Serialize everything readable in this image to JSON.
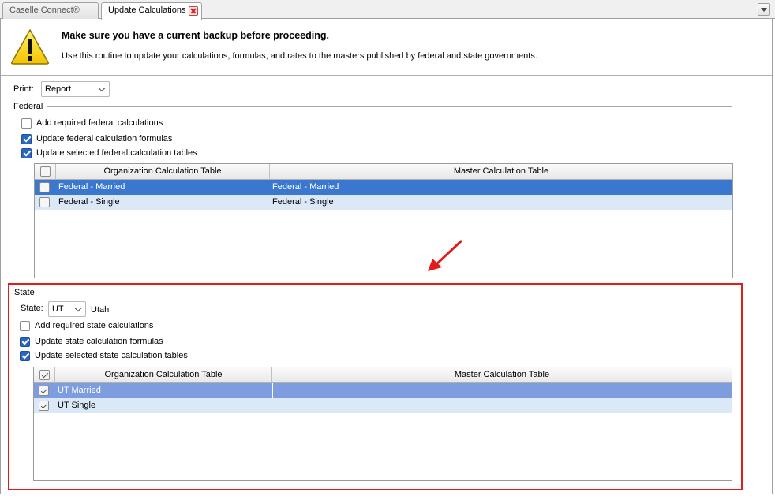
{
  "tabs": [
    {
      "label": "Caselle Connect®",
      "active": false
    },
    {
      "label": "Update Calculations",
      "active": true
    }
  ],
  "icons": {
    "tab_close": "close-icon",
    "tab_menu": "chevron-down-icon",
    "warning": "warning-icon",
    "arrow": "red-arrow-icon"
  },
  "banner": {
    "title": "Make sure you have a current backup before proceeding.",
    "subtitle": "Use this routine to update your calculations, formulas, and rates to the masters published by federal and state governments."
  },
  "print": {
    "label": "Print:",
    "value": "Report"
  },
  "federal": {
    "title": "Federal",
    "options": [
      {
        "label": "Add required federal calculations",
        "checked": false
      },
      {
        "label": "Update federal calculation formulas",
        "checked": true
      },
      {
        "label": "Update selected federal calculation tables",
        "checked": true
      }
    ],
    "table": {
      "headers": {
        "org": "Organization Calculation Table",
        "master": "Master Calculation Table"
      },
      "rows": [
        {
          "org": "Federal - Married",
          "master": "Federal - Married",
          "selected": true,
          "checked": false
        },
        {
          "org": "Federal - Single",
          "master": "Federal - Single",
          "selected": false,
          "checked": false
        }
      ]
    }
  },
  "state": {
    "title": "State",
    "state_label": "State:",
    "state_value": "UT",
    "state_name": "Utah",
    "options": [
      {
        "label": "Add required state calculations",
        "checked": false
      },
      {
        "label": "Update state calculation formulas",
        "checked": true
      },
      {
        "label": "Update selected state calculation tables",
        "checked": true
      }
    ],
    "table": {
      "header_checked": true,
      "headers": {
        "org": "Organization Calculation Table",
        "master": "Master Calculation Table"
      },
      "rows": [
        {
          "org": "UT Married",
          "master": "",
          "selected": true,
          "checked": true
        },
        {
          "org": "UT Single",
          "master": "",
          "selected": false,
          "checked": true
        }
      ]
    }
  },
  "colors": {
    "selected_row_federal": "#3a78cf",
    "selected_row_state": "#7e9ddf",
    "alt_row": "#dbe8f8",
    "highlight_box": "#e21b1b",
    "checkbox_blue": "#2a66c4"
  }
}
